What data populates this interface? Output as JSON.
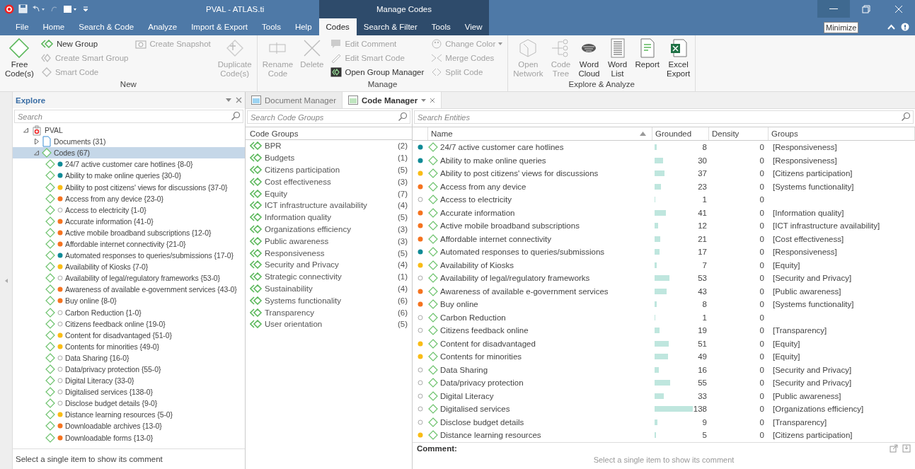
{
  "title_bar": {
    "title": "PVAL - ATLAS.ti",
    "context_title": "Manage Codes",
    "tooltip": "Minimize"
  },
  "menu_tabs": [
    {
      "label": "File",
      "selected": false,
      "contextual": false
    },
    {
      "label": "Home",
      "selected": false,
      "contextual": false
    },
    {
      "label": "Search & Code",
      "selected": false,
      "contextual": false
    },
    {
      "label": "Analyze",
      "selected": false,
      "contextual": false
    },
    {
      "label": "Import & Export",
      "selected": false,
      "contextual": false
    },
    {
      "label": "Tools",
      "selected": false,
      "contextual": false
    },
    {
      "label": "Help",
      "selected": false,
      "contextual": false
    },
    {
      "label": "Codes",
      "selected": true,
      "contextual": true
    },
    {
      "label": "Search & Filter",
      "selected": false,
      "contextual": true
    },
    {
      "label": "Tools",
      "selected": false,
      "contextual": true
    },
    {
      "label": "View",
      "selected": false,
      "contextual": true
    }
  ],
  "ribbon": [
    {
      "name": "New",
      "columns": [
        [
          {
            "kind": "large",
            "label": "Free Code(s)",
            "disabled": false
          }
        ],
        [
          {
            "kind": "small",
            "label": "New Group",
            "disabled": false
          },
          {
            "kind": "small",
            "label": "Create Smart Group",
            "disabled": true
          },
          {
            "kind": "small",
            "label": "Smart Code",
            "disabled": true
          }
        ],
        [
          {
            "kind": "small",
            "label": "Create Snapshot",
            "disabled": true
          }
        ],
        [
          {
            "kind": "large",
            "label": "Duplicate Code(s)",
            "disabled": true
          }
        ]
      ]
    },
    {
      "name": "Manage",
      "columns": [
        [
          {
            "kind": "large",
            "label": "Rename Code",
            "disabled": true
          }
        ],
        [
          {
            "kind": "large",
            "label": "Delete",
            "disabled": true
          }
        ],
        [
          {
            "kind": "small",
            "label": "Edit Comment",
            "disabled": true
          },
          {
            "kind": "small",
            "label": "Edit Smart Code",
            "disabled": true
          },
          {
            "kind": "small",
            "label": "Open Group Manager",
            "disabled": false
          }
        ],
        [
          {
            "kind": "small",
            "label": "Change Color",
            "disabled": true,
            "dropdown": true
          },
          {
            "kind": "small",
            "label": "Merge Codes",
            "disabled": true
          },
          {
            "kind": "small",
            "label": "Split Code",
            "disabled": true
          }
        ]
      ]
    },
    {
      "name": "Explore & Analyze",
      "columns": [
        [
          {
            "kind": "large",
            "label": "Open Network",
            "disabled": true
          }
        ],
        [
          {
            "kind": "large",
            "label": "Code Tree",
            "disabled": true
          }
        ],
        [
          {
            "kind": "large",
            "label": "Word Cloud",
            "disabled": false
          }
        ],
        [
          {
            "kind": "large",
            "label": "Word List",
            "disabled": false
          }
        ],
        [
          {
            "kind": "large",
            "label": "Report",
            "disabled": false
          }
        ],
        [
          {
            "kind": "large",
            "label": "Excel Export",
            "disabled": false
          }
        ]
      ]
    }
  ],
  "explore": {
    "title": "Explore",
    "search_placeholder": "Search",
    "tree": [
      {
        "kind": "project",
        "label": "PVAL",
        "expanded": true,
        "selected": false,
        "children": [
          {
            "kind": "documents",
            "label": "Documents (31)",
            "expanded": false,
            "selected": false
          },
          {
            "kind": "codes",
            "label": "Codes (67)",
            "expanded": true,
            "selected": true,
            "children": [
              {
                "kind": "code",
                "label": "24/7 active customer care hotlines {8-0}",
                "color": "#0e8a96"
              },
              {
                "kind": "code",
                "label": "Ability to make online queries {30-0}",
                "color": "#0e8a96"
              },
              {
                "kind": "code",
                "label": "Ability to post citizens' views for discussions {37-0}",
                "color": "#f9bc15"
              },
              {
                "kind": "code",
                "label": "Access from any device {23-0}",
                "color": "#f5731f"
              },
              {
                "kind": "code",
                "label": "Access to electricity {1-0}"
              },
              {
                "kind": "code",
                "label": "Accurate information {41-0}",
                "color": "#f5731f"
              },
              {
                "kind": "code",
                "label": "Active mobile broadband subscriptions {12-0}",
                "color": "#f5731f"
              },
              {
                "kind": "code",
                "label": "Affordable internet connectivity {21-0}",
                "color": "#f5731f"
              },
              {
                "kind": "code",
                "label": "Automated responses to queries/submissions {17-0}",
                "color": "#0e8a96"
              },
              {
                "kind": "code",
                "label": "Availability of Kiosks {7-0}",
                "color": "#f9bc15"
              },
              {
                "kind": "code",
                "label": "Availability of legal/regulatory frameworks {53-0}"
              },
              {
                "kind": "code",
                "label": "Awareness of available e-government services {43-0}",
                "color": "#f5731f"
              },
              {
                "kind": "code",
                "label": "Buy online {8-0}",
                "color": "#f5731f"
              },
              {
                "kind": "code",
                "label": "Carbon Reduction {1-0}"
              },
              {
                "kind": "code",
                "label": "Citizens feedback online {19-0}"
              },
              {
                "kind": "code",
                "label": "Content for disadvantaged {51-0}",
                "color": "#f9bc15"
              },
              {
                "kind": "code",
                "label": "Contents for minorities {49-0}",
                "color": "#f9bc15"
              },
              {
                "kind": "code",
                "label": "Data Sharing {16-0}"
              },
              {
                "kind": "code",
                "label": "Data/privacy protection {55-0}"
              },
              {
                "kind": "code",
                "label": "Digital Literacy {33-0}"
              },
              {
                "kind": "code",
                "label": "Digitalised services {138-0}"
              },
              {
                "kind": "code",
                "label": "Disclose budget details {9-0}"
              },
              {
                "kind": "code",
                "label": "Distance learning resources {5-0}",
                "color": "#f9bc15"
              },
              {
                "kind": "code",
                "label": "Downloadable archives {13-0}",
                "color": "#f5731f"
              },
              {
                "kind": "code",
                "label": "Downloadable forms {13-0}",
                "color": "#f5731f"
              }
            ]
          }
        ]
      }
    ],
    "comment_hint": "Select a single item to show its comment"
  },
  "doc_tabs": [
    {
      "label": "Document Manager",
      "selected": false
    },
    {
      "label": "Code Manager",
      "selected": true
    }
  ],
  "code_groups": {
    "search_placeholder": "Search Code Groups",
    "header": "Code Groups",
    "items": [
      {
        "label": "BPR",
        "count": "(2)"
      },
      {
        "label": "Budgets",
        "count": "(1)"
      },
      {
        "label": "Citizens participation",
        "count": "(5)"
      },
      {
        "label": "Cost effectiveness",
        "count": "(3)"
      },
      {
        "label": "Equity",
        "count": "(7)"
      },
      {
        "label": "ICT infrastructure availability",
        "count": "(4)"
      },
      {
        "label": "Information quality",
        "count": "(5)"
      },
      {
        "label": "Organizations efficiency",
        "count": "(3)"
      },
      {
        "label": "Public awareness",
        "count": "(3)"
      },
      {
        "label": "Responsiveness",
        "count": "(5)"
      },
      {
        "label": "Security and Privacy",
        "count": "(4)"
      },
      {
        "label": "Strategic connectivity",
        "count": "(1)"
      },
      {
        "label": "Sustainability",
        "count": "(4)"
      },
      {
        "label": "Systems functionality",
        "count": "(6)"
      },
      {
        "label": "Transparency",
        "count": "(6)"
      },
      {
        "label": "User orientation",
        "count": "(5)"
      }
    ]
  },
  "entities": {
    "search_placeholder": "Search Entities",
    "columns": [
      {
        "label": "Name",
        "sorted": true
      },
      {
        "label": "Grounded"
      },
      {
        "label": "Density"
      },
      {
        "label": "Groups"
      }
    ],
    "rows": [
      {
        "color": "#0e8a96",
        "name": "24/7 active customer care hotlines",
        "grounded": "8",
        "density": "0",
        "groups": "[Responsiveness]"
      },
      {
        "color": "#0e8a96",
        "name": "Ability to make online queries",
        "grounded": "30",
        "density": "0",
        "groups": "[Responsiveness]"
      },
      {
        "color": "#f9bc15",
        "name": "Ability to post citizens' views for discussions",
        "grounded": "37",
        "density": "0",
        "groups": "[Citizens participation]"
      },
      {
        "color": "#f5731f",
        "name": "Access from any device",
        "grounded": "23",
        "density": "0",
        "groups": "[Systems functionality]"
      },
      {
        "name": "Access to electricity",
        "grounded": "1",
        "density": "0"
      },
      {
        "color": "#f5731f",
        "name": "Accurate information",
        "grounded": "41",
        "density": "0",
        "groups": "[Information quality]"
      },
      {
        "color": "#f5731f",
        "name": "Active mobile broadband subscriptions",
        "grounded": "12",
        "density": "0",
        "groups": "[ICT infrastructure availability]"
      },
      {
        "color": "#f5731f",
        "name": "Affordable internet connectivity",
        "grounded": "21",
        "density": "0",
        "groups": "[Cost effectiveness]"
      },
      {
        "color": "#0e8a96",
        "name": "Automated responses to queries/submissions",
        "grounded": "17",
        "density": "0",
        "groups": "[Responsiveness]"
      },
      {
        "color": "#f9bc15",
        "name": "Availability of Kiosks",
        "grounded": "7",
        "density": "0",
        "groups": "[Equity]"
      },
      {
        "name": "Availability of legal/regulatory frameworks",
        "grounded": "53",
        "density": "0",
        "groups": "[Security and Privacy]"
      },
      {
        "color": "#f5731f",
        "name": "Awareness of available e-government services",
        "grounded": "43",
        "density": "0",
        "groups": "[Public awareness]"
      },
      {
        "color": "#f5731f",
        "name": "Buy online",
        "grounded": "8",
        "density": "0",
        "groups": "[Systems functionality]"
      },
      {
        "name": "Carbon Reduction",
        "grounded": "1",
        "density": "0"
      },
      {
        "name": "Citizens feedback online",
        "grounded": "19",
        "density": "0",
        "groups": "[Transparency]"
      },
      {
        "color": "#f9bc15",
        "name": "Content for disadvantaged",
        "grounded": "51",
        "density": "0",
        "groups": "[Equity]"
      },
      {
        "color": "#f9bc15",
        "name": "Contents for minorities",
        "grounded": "49",
        "density": "0",
        "groups": "[Equity]"
      },
      {
        "name": "Data Sharing",
        "grounded": "16",
        "density": "0",
        "groups": "[Security and Privacy]"
      },
      {
        "name": "Data/privacy protection",
        "grounded": "55",
        "density": "0",
        "groups": "[Security and Privacy]"
      },
      {
        "name": "Digital Literacy",
        "grounded": "33",
        "density": "0",
        "groups": "[Public awareness]"
      },
      {
        "name": "Digitalised services",
        "grounded": "138",
        "density": "0",
        "groups": "[Organizations efficiency]"
      },
      {
        "name": "Disclose budget details",
        "grounded": "9",
        "density": "0",
        "groups": "[Transparency]"
      },
      {
        "color": "#f9bc15",
        "name": "Distance learning resources",
        "grounded": "5",
        "density": "0",
        "groups": "[Citizens participation]"
      }
    ],
    "comment_label": "Comment:",
    "comment_hint": "Select a single item to show its comment"
  }
}
